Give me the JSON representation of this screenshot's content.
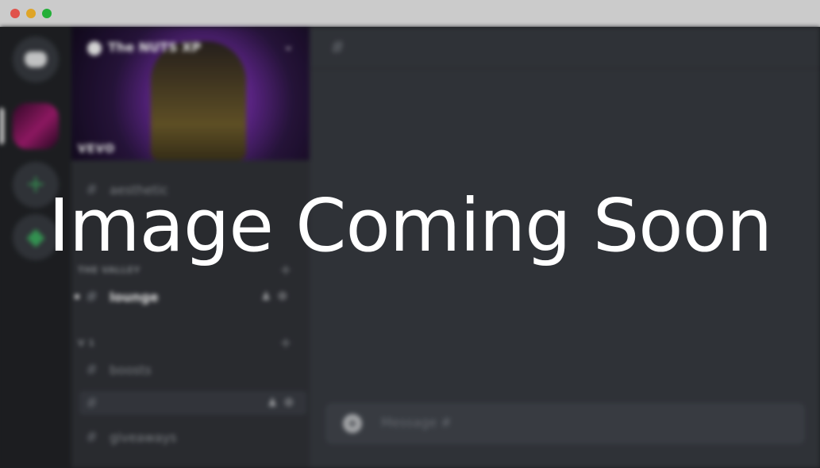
{
  "overlay": {
    "text": "Image Coming Soon"
  },
  "server": {
    "name": "The NUTS XP",
    "banner_label": "VEVO"
  },
  "categories": [
    {
      "name": "THE VALLEY"
    },
    {
      "name": "V 1"
    }
  ],
  "channels": [
    {
      "name": "aesthetic"
    },
    {
      "name": "lounge"
    },
    {
      "name": "boosts"
    },
    {
      "name": ""
    },
    {
      "name": "giveaways"
    }
  ],
  "composer": {
    "placeholder": "Message #"
  },
  "icons": {
    "home": "discord-icon",
    "add": "plus-icon",
    "explore": "compass-icon"
  }
}
